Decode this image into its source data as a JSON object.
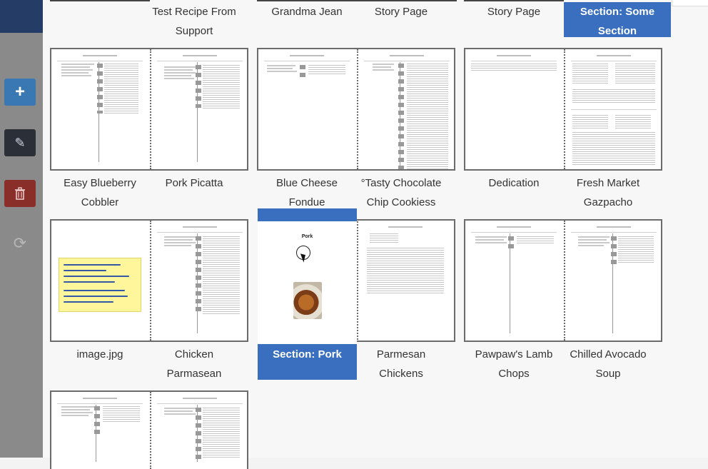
{
  "left_rail": {
    "add_icon": "plus-icon",
    "edit_icon": "pencil-icon",
    "delete_icon": "trash-icon",
    "sync_icon": "refresh-icon",
    "add_glyph": "+",
    "edit_glyph": "✎",
    "sync_glyph": "⟳"
  },
  "row0": {
    "labels": [
      {
        "line1": "Test Recipe From",
        "line2": "Support"
      },
      {
        "line1": "Grandma Jean"
      },
      {
        "line1": "Story Page"
      },
      {
        "line1": "Story Page"
      },
      {
        "line1": "Section: Some",
        "line2": "Section",
        "selected": true
      }
    ]
  },
  "row1": {
    "spreads": [
      {
        "left": {
          "line1": "Easy Blueberry",
          "line2": "Cobbler"
        },
        "right": {
          "line1": "Pork Picatta"
        }
      },
      {
        "left": {
          "line1": "Blue Cheese Fondue"
        },
        "right": {
          "line1": "°Tasty Chocolate",
          "line2": "Chip Cookiess"
        }
      },
      {
        "left": {
          "line1": "Dedication"
        },
        "right": {
          "line1": "Fresh Market",
          "line2": "Gazpacho"
        }
      }
    ]
  },
  "row2": {
    "spreads": [
      {
        "left": {
          "line1": "image.jpg"
        },
        "right": {
          "line1": "Chicken",
          "line2": "Parmasean"
        }
      },
      {
        "left": {
          "line1": "Section: Pork",
          "selected": true,
          "page_title": "Pork"
        },
        "right": {
          "line1": "Parmesan",
          "line2": "Chickens"
        }
      },
      {
        "left": {
          "line1": "Pawpaw's Lamb",
          "line2": "Chops"
        },
        "right": {
          "line1": "Chilled Avocado",
          "line2": "Soup"
        }
      }
    ]
  },
  "colors": {
    "accent": "#3a6fbf",
    "nav_dark": "#243c66",
    "add_button": "#3a78b3",
    "edit_button": "#2a2f38",
    "delete_button": "#8a2e2a"
  }
}
